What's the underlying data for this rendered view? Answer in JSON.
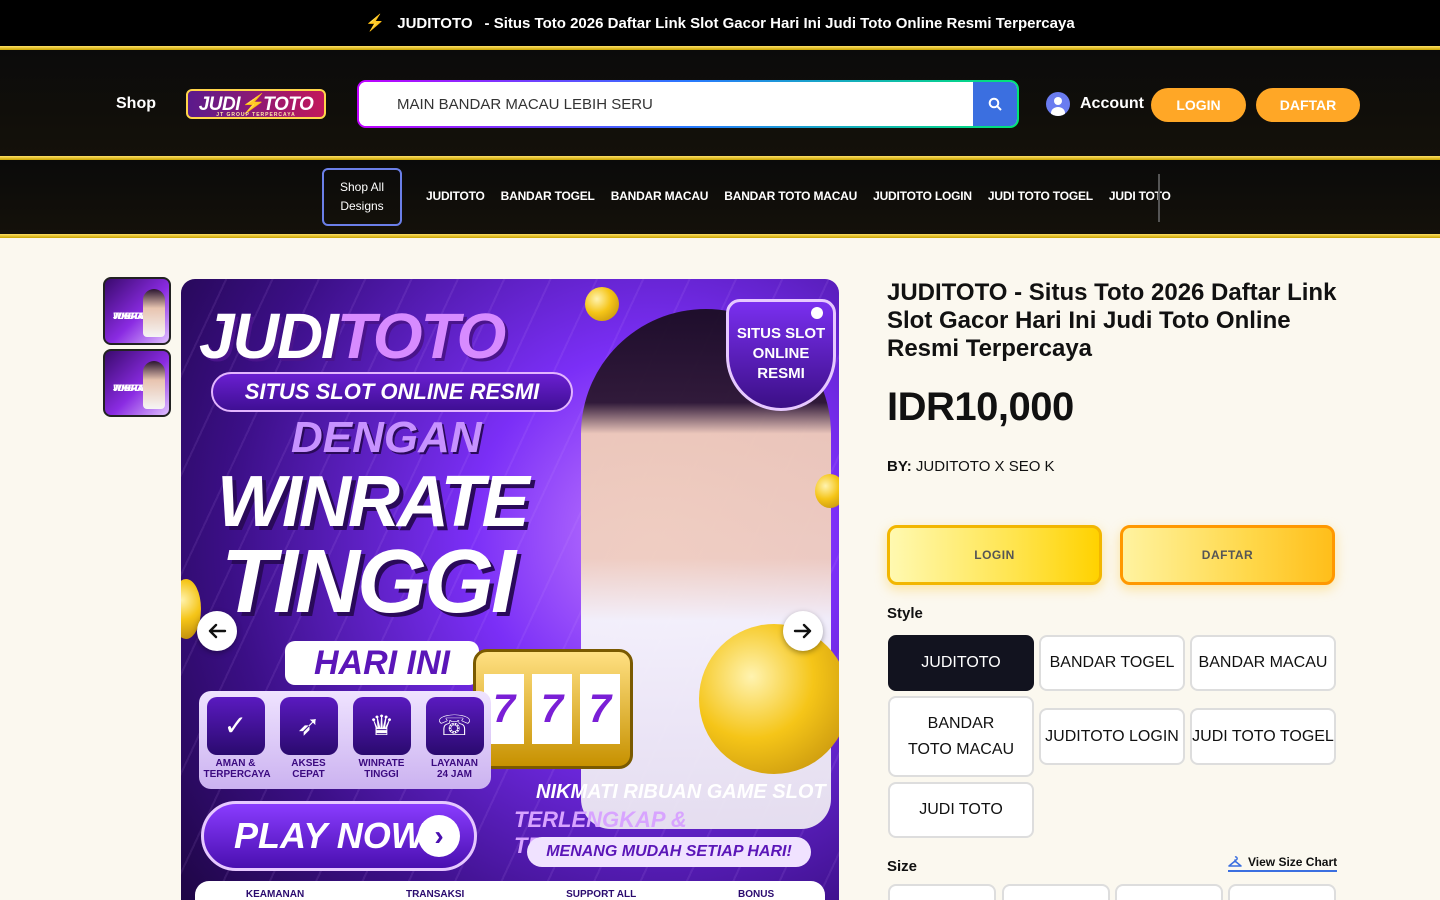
{
  "announcement": {
    "brand": "JUDITOTO",
    "text": "- Situs Toto 2026 Daftar Link Slot Gacor Hari Ini Judi Toto Online Resmi Terpercaya"
  },
  "header": {
    "shop_label": "Shop",
    "logo_text": "JUDI⚡TOTO",
    "logo_tagline": "JT GROUP TERPERCAYA",
    "search_placeholder": "MAIN BANDAR MACAU LEBIH SERU",
    "account_label": "Account",
    "login_label": "LOGIN",
    "daftar_label": "DAFTAR"
  },
  "nav": {
    "shop_all_line1": "Shop All",
    "shop_all_line2": "Designs",
    "links": [
      "JUDITOTO",
      "BANDAR TOGEL",
      "BANDAR MACAU",
      "BANDAR TOTO MACAU",
      "JUDITOTO LOGIN",
      "JUDI TOTO TOGEL",
      "JUDI TOTO"
    ]
  },
  "banner": {
    "title_white": "JUDI",
    "title_pink": "TOTO",
    "ribbon": "SITUS SLOT ONLINE RESMI",
    "dengan": "DENGAN",
    "winrate": "WINRATE",
    "tinggi": "TINGGI",
    "hari_ini": "HARI INI",
    "shield_line1": "SITUS SLOT",
    "shield_line2": "ONLINE",
    "shield_line3": "RESMI",
    "features": [
      {
        "icon": "✓",
        "label1": "AMAN &",
        "label2": "TERPERCAYA"
      },
      {
        "icon": "➶",
        "label1": "AKSES",
        "label2": "CEPAT"
      },
      {
        "icon": "♛",
        "label1": "WINRATE",
        "label2": "TINGGI"
      },
      {
        "icon": "☏",
        "label1": "LAYANAN",
        "label2": "24 JAM"
      }
    ],
    "nikmati": "NIKMATI RIBUAN GAME SLOT",
    "lengkap": "TERLENGKAP & TERPOPULER",
    "menang": "MENANG MUDAH SETIAP HARI!",
    "play_now": "PLAY NOW",
    "bottom_items": [
      "KEAMANAN",
      "TRANSAKSI",
      "SUPPORT ALL",
      "BONUS"
    ],
    "slot_digits": [
      "7",
      "7",
      "7"
    ]
  },
  "thumbs": [
    {
      "text1": "JUDITOTO",
      "text2": "WINRATE",
      "text3": "TINGGI"
    },
    {
      "text1": "JUDITOTO",
      "text2": "WINRATE",
      "text3": "TINGGI"
    }
  ],
  "product": {
    "title": "JUDITOTO - Situs Toto 2026 Daftar Link Slot Gacor Hari Ini Judi Toto Online Resmi Terpercaya",
    "price": "IDR10,000",
    "by_label": "BY:",
    "by_value": "JUDITOTO X SEO K",
    "login_cta": "LOGIN",
    "daftar_cta": "DAFTAR",
    "style_label": "Style",
    "styles": [
      "JUDITOTO",
      "BANDAR TOGEL",
      "BANDAR MACAU",
      "BANDAR TOTO MACAU",
      "JUDITOTO LOGIN",
      "JUDI TOTO TOGEL",
      "JUDI TOTO"
    ],
    "selected_style": "JUDITOTO",
    "size_label": "Size",
    "size_chart_label": "View Size Chart"
  },
  "colors": {
    "accent_orange": "#ffa726",
    "search_button": "#3b6fe0",
    "selected_style": "#12131f",
    "gold": "#ffd200"
  }
}
